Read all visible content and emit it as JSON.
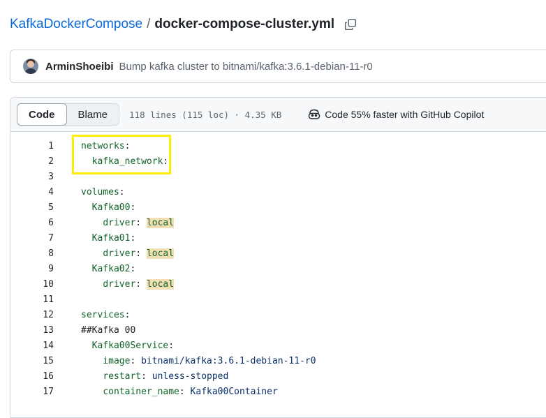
{
  "breadcrumb": {
    "repo": "KafkaDockerCompose",
    "separator": "/",
    "file": "docker-compose-cluster.yml",
    "copy_icon": "copy-icon"
  },
  "commit": {
    "author": "ArminShoeibi",
    "message": "Bump kafka cluster to bitnami/kafka:3.6.1-debian-11-r0",
    "avatar_icon": "avatar"
  },
  "toolbar": {
    "code_label": "Code",
    "blame_label": "Blame",
    "stats": "118 lines (115 loc) · 4.35 KB",
    "copilot_label": "Code 55% faster with GitHub Copilot",
    "copilot_icon": "copilot-icon"
  },
  "annotation": {
    "color": "#ffee00",
    "highlighted_lines": [
      1,
      2
    ]
  },
  "code_lines": [
    {
      "num": "1",
      "key": "networks",
      "colon": ":",
      "value": "",
      "indent": ""
    },
    {
      "num": "2",
      "key": "kafka_network",
      "colon": ":",
      "value": "",
      "indent": "  "
    },
    {
      "num": "3",
      "key": "",
      "colon": "",
      "value": "",
      "indent": ""
    },
    {
      "num": "4",
      "key": "volumes",
      "colon": ":",
      "value": "",
      "indent": ""
    },
    {
      "num": "5",
      "key": "Kafka00",
      "colon": ":",
      "value": "",
      "indent": "  "
    },
    {
      "num": "6",
      "key": "driver",
      "colon": ": ",
      "value": "local",
      "indent": "    ",
      "value_hl": true
    },
    {
      "num": "7",
      "key": "Kafka01",
      "colon": ":",
      "value": "",
      "indent": "  "
    },
    {
      "num": "8",
      "key": "driver",
      "colon": ": ",
      "value": "local",
      "indent": "    ",
      "value_hl": true
    },
    {
      "num": "9",
      "key": "Kafka02",
      "colon": ":",
      "value": "",
      "indent": "  "
    },
    {
      "num": "10",
      "key": "driver",
      "colon": ": ",
      "value": "local",
      "indent": "    ",
      "value_hl": true
    },
    {
      "num": "11",
      "key": "",
      "colon": "",
      "value": "",
      "indent": ""
    },
    {
      "num": "12",
      "key": "services",
      "colon": ":",
      "value": "",
      "indent": ""
    },
    {
      "num": "13",
      "comment": "##Kafka 00",
      "key": "",
      "colon": "",
      "value": "",
      "indent": ""
    },
    {
      "num": "14",
      "key": "Kafka00Service",
      "colon": ":",
      "value": "",
      "indent": "  "
    },
    {
      "num": "15",
      "key": "image",
      "colon": ": ",
      "value": "bitnami/kafka:3.6.1-debian-11-r0",
      "indent": "    "
    },
    {
      "num": "16",
      "key": "restart",
      "colon": ": ",
      "value": "unless-stopped",
      "indent": "    "
    },
    {
      "num": "17",
      "key": "container_name",
      "colon": ": ",
      "value": "Kafka00Container",
      "indent": "    "
    }
  ]
}
